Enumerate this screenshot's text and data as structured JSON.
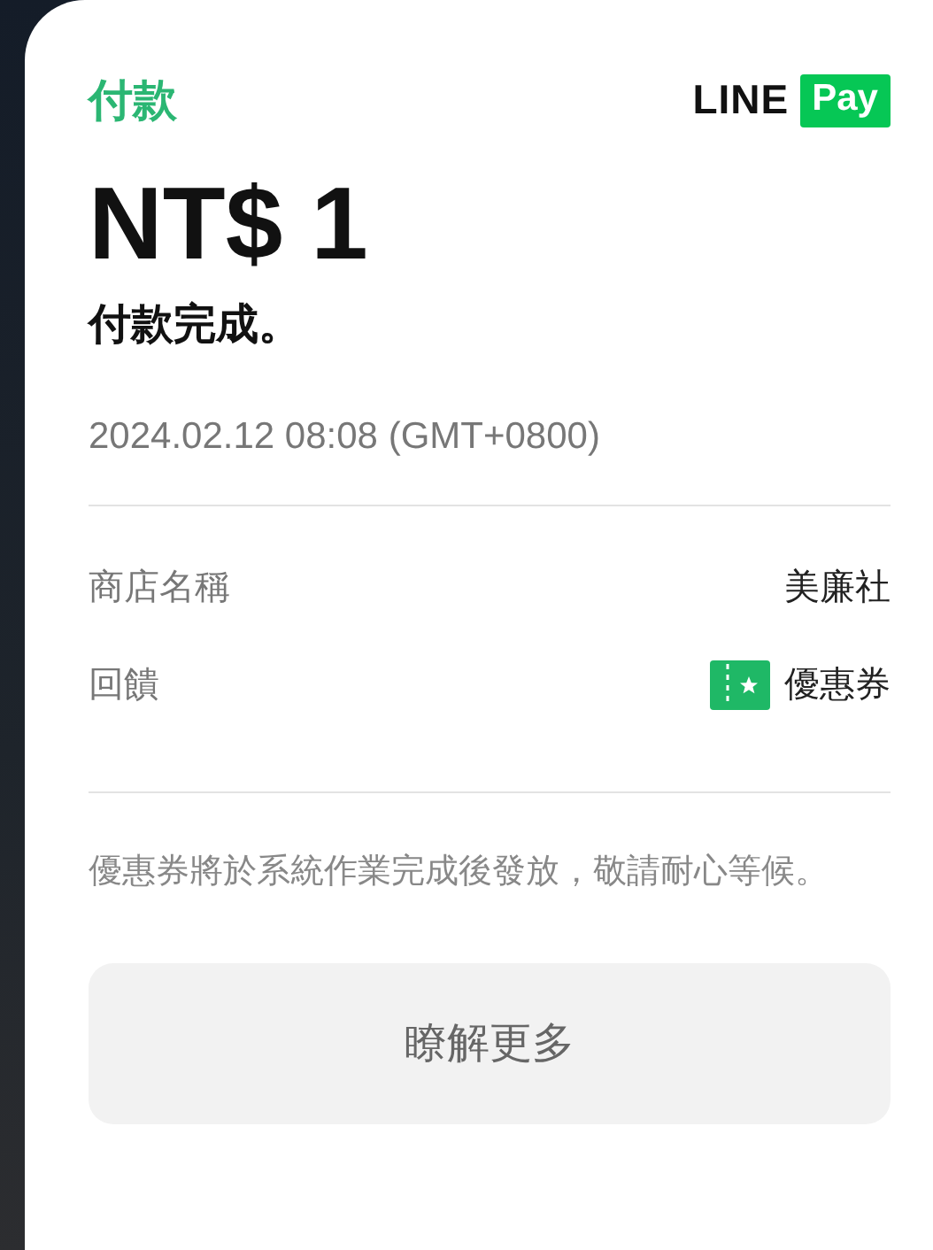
{
  "header": {
    "title": "付款",
    "logo": {
      "word": "LINE",
      "badge": "Pay"
    }
  },
  "amount": "NT$ 1",
  "status": "付款完成。",
  "timestamp": "2024.02.12 08:08 (GMT+0800)",
  "details": [
    {
      "label": "商店名稱",
      "value": "美廉社",
      "kind": "text"
    },
    {
      "label": "回饋",
      "value": "優惠券",
      "kind": "coupon"
    }
  ],
  "note": "優惠券將於系統作業完成後發放，敬請耐心等候。",
  "button": "瞭解更多"
}
